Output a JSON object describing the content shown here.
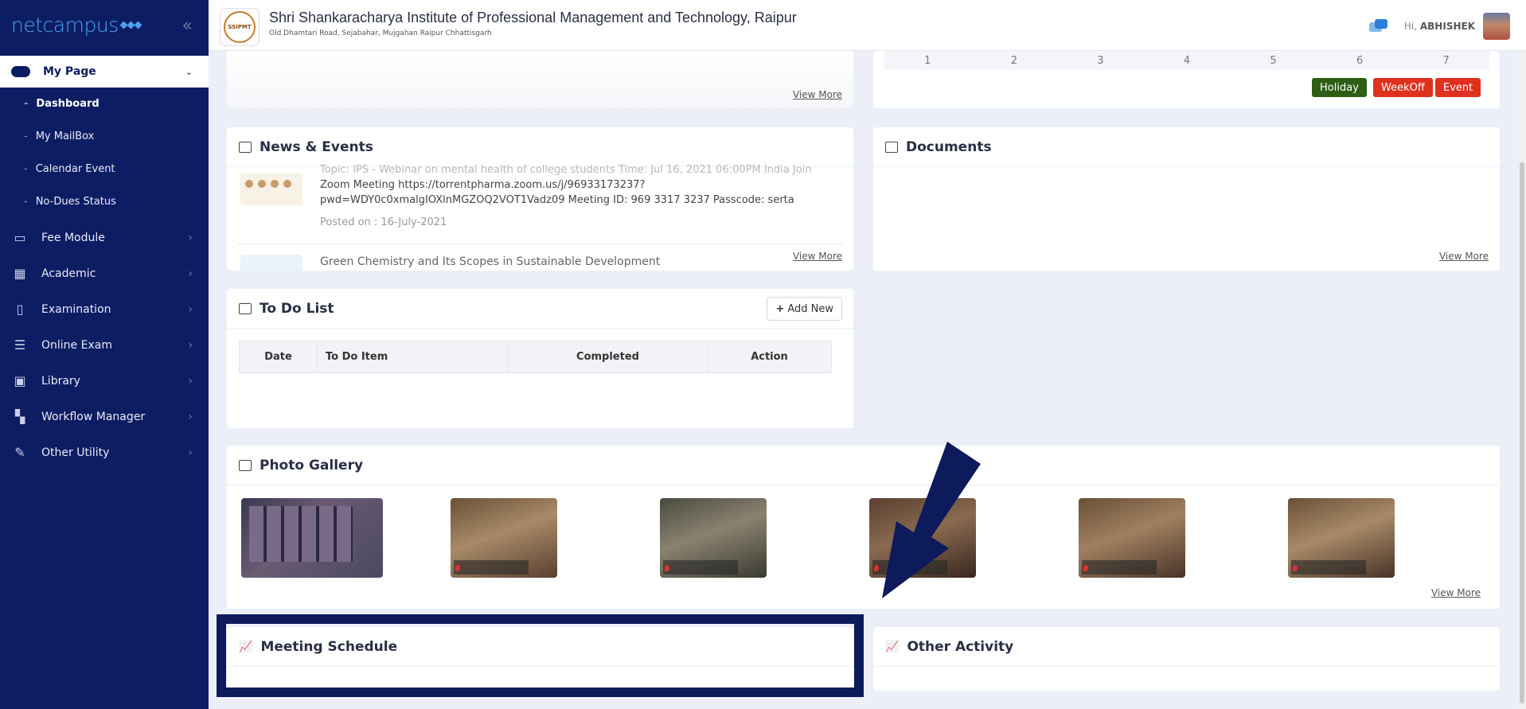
{
  "sidebar": {
    "brand": "netcampus",
    "main_item": "My Page",
    "subitems": [
      "Dashboard",
      "My MailBox",
      "Calendar Event",
      "No-Dues Status"
    ],
    "menu": [
      {
        "label": "Fee Module",
        "icon": "money-icon"
      },
      {
        "label": "Academic",
        "icon": "building-icon"
      },
      {
        "label": "Examination",
        "icon": "clipboard-icon"
      },
      {
        "label": "Online Exam",
        "icon": "list-icon"
      },
      {
        "label": "Library",
        "icon": "book-icon"
      },
      {
        "label": "Workflow Manager",
        "icon": "workflow-icon"
      },
      {
        "label": "Other Utility",
        "icon": "tools-icon"
      }
    ]
  },
  "header": {
    "institute": "Shri Shankaracharya Institute of Professional Management and Technology, Raipur",
    "address": "Old Dhamtari Road, Sejabahar, Mujgahan Raipur Chhattisgarh",
    "logo_text": "SSIPMT",
    "greeting": "Hi,",
    "user": "ABHISHEK"
  },
  "calendar": {
    "days": [
      "1",
      "2",
      "3",
      "4",
      "5",
      "6",
      "7"
    ],
    "legend": [
      {
        "label": "Holiday",
        "color": "#2e5e14"
      },
      {
        "label": "WeekOff",
        "color": "#e0301e"
      },
      {
        "label": "Event",
        "color": "#e0301e"
      }
    ]
  },
  "view_more": "View More",
  "news": {
    "title": "News & Events",
    "item1_line0": "Topic: IPS - Webinar on mental health of college students Time: Jul 16, 2021 06:00PM India Join",
    "item1_line1": "Zoom Meeting https://torrentpharma.zoom.us/j/96933173237?",
    "item1_line2": "pwd=WDY0c0xmalgIOXlnMGZOQ2VOT1Vadz09 Meeting ID: 969 3317 3237 Passcode: serta",
    "item1_posted": "Posted on : 16-July-2021",
    "item2_title": "Green Chemistry and Its Scopes in Sustainable Development"
  },
  "documents": {
    "title": "Documents"
  },
  "todo": {
    "title": "To Do List",
    "add_new": "Add New",
    "columns": [
      "Date",
      "To Do Item",
      "Completed",
      "Action"
    ]
  },
  "gallery": {
    "title": "Photo Gallery"
  },
  "meeting": {
    "title": "Meeting Schedule"
  },
  "activity": {
    "title": "Other Activity"
  }
}
